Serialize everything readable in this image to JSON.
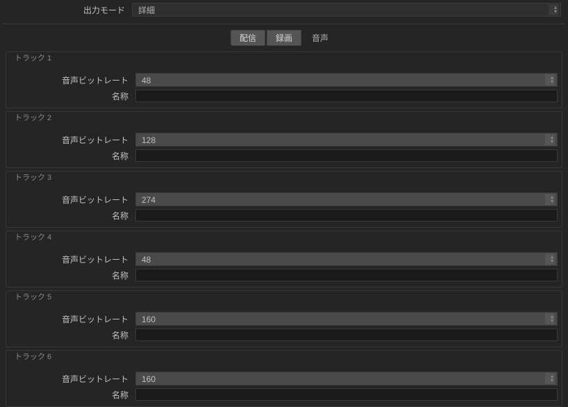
{
  "outputMode": {
    "label": "出力モード",
    "value": "詳細"
  },
  "tabs": {
    "streaming": "配信",
    "recording": "録画",
    "audio": "音声"
  },
  "labels": {
    "bitrate": "音声ビットレート",
    "name": "名称"
  },
  "tracks": [
    {
      "title": "トラック 1",
      "bitrate": "48",
      "name": ""
    },
    {
      "title": "トラック 2",
      "bitrate": "128",
      "name": ""
    },
    {
      "title": "トラック 3",
      "bitrate": "274",
      "name": ""
    },
    {
      "title": "トラック 4",
      "bitrate": "48",
      "name": ""
    },
    {
      "title": "トラック 5",
      "bitrate": "160",
      "name": ""
    },
    {
      "title": "トラック 6",
      "bitrate": "160",
      "name": ""
    }
  ]
}
